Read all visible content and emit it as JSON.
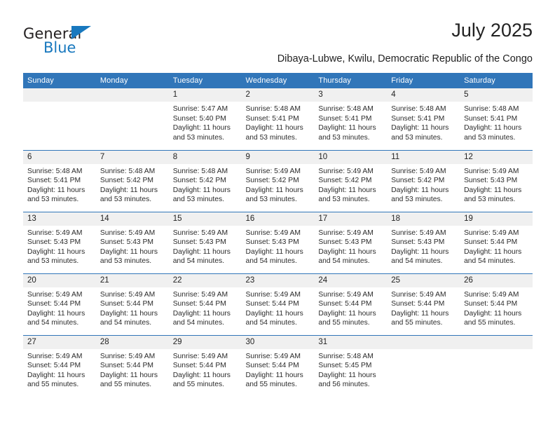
{
  "logo": {
    "word_top": "General",
    "word_bottom": "Blue",
    "triangle_icon": "triangle-icon",
    "color_blue": "#1878be",
    "color_dark": "#231f20"
  },
  "header": {
    "title": "July 2025",
    "subtitle": "Dibaya-Lubwe, Kwilu, Democratic Republic of the Congo"
  },
  "theme": {
    "header_blue": "#3176b9",
    "daynum_bg": "#f0f0f0",
    "text": "#222222"
  },
  "calendar": {
    "weekday_headers": [
      "Sunday",
      "Monday",
      "Tuesday",
      "Wednesday",
      "Thursday",
      "Friday",
      "Saturday"
    ],
    "weeks": [
      [
        {
          "day": "",
          "lines": []
        },
        {
          "day": "",
          "lines": []
        },
        {
          "day": "1",
          "lines": [
            "Sunrise: 5:47 AM",
            "Sunset: 5:40 PM",
            "Daylight: 11 hours",
            "and 53 minutes."
          ]
        },
        {
          "day": "2",
          "lines": [
            "Sunrise: 5:48 AM",
            "Sunset: 5:41 PM",
            "Daylight: 11 hours",
            "and 53 minutes."
          ]
        },
        {
          "day": "3",
          "lines": [
            "Sunrise: 5:48 AM",
            "Sunset: 5:41 PM",
            "Daylight: 11 hours",
            "and 53 minutes."
          ]
        },
        {
          "day": "4",
          "lines": [
            "Sunrise: 5:48 AM",
            "Sunset: 5:41 PM",
            "Daylight: 11 hours",
            "and 53 minutes."
          ]
        },
        {
          "day": "5",
          "lines": [
            "Sunrise: 5:48 AM",
            "Sunset: 5:41 PM",
            "Daylight: 11 hours",
            "and 53 minutes."
          ]
        }
      ],
      [
        {
          "day": "6",
          "lines": [
            "Sunrise: 5:48 AM",
            "Sunset: 5:41 PM",
            "Daylight: 11 hours",
            "and 53 minutes."
          ]
        },
        {
          "day": "7",
          "lines": [
            "Sunrise: 5:48 AM",
            "Sunset: 5:42 PM",
            "Daylight: 11 hours",
            "and 53 minutes."
          ]
        },
        {
          "day": "8",
          "lines": [
            "Sunrise: 5:48 AM",
            "Sunset: 5:42 PM",
            "Daylight: 11 hours",
            "and 53 minutes."
          ]
        },
        {
          "day": "9",
          "lines": [
            "Sunrise: 5:49 AM",
            "Sunset: 5:42 PM",
            "Daylight: 11 hours",
            "and 53 minutes."
          ]
        },
        {
          "day": "10",
          "lines": [
            "Sunrise: 5:49 AM",
            "Sunset: 5:42 PM",
            "Daylight: 11 hours",
            "and 53 minutes."
          ]
        },
        {
          "day": "11",
          "lines": [
            "Sunrise: 5:49 AM",
            "Sunset: 5:42 PM",
            "Daylight: 11 hours",
            "and 53 minutes."
          ]
        },
        {
          "day": "12",
          "lines": [
            "Sunrise: 5:49 AM",
            "Sunset: 5:43 PM",
            "Daylight: 11 hours",
            "and 53 minutes."
          ]
        }
      ],
      [
        {
          "day": "13",
          "lines": [
            "Sunrise: 5:49 AM",
            "Sunset: 5:43 PM",
            "Daylight: 11 hours",
            "and 53 minutes."
          ]
        },
        {
          "day": "14",
          "lines": [
            "Sunrise: 5:49 AM",
            "Sunset: 5:43 PM",
            "Daylight: 11 hours",
            "and 53 minutes."
          ]
        },
        {
          "day": "15",
          "lines": [
            "Sunrise: 5:49 AM",
            "Sunset: 5:43 PM",
            "Daylight: 11 hours",
            "and 54 minutes."
          ]
        },
        {
          "day": "16",
          "lines": [
            "Sunrise: 5:49 AM",
            "Sunset: 5:43 PM",
            "Daylight: 11 hours",
            "and 54 minutes."
          ]
        },
        {
          "day": "17",
          "lines": [
            "Sunrise: 5:49 AM",
            "Sunset: 5:43 PM",
            "Daylight: 11 hours",
            "and 54 minutes."
          ]
        },
        {
          "day": "18",
          "lines": [
            "Sunrise: 5:49 AM",
            "Sunset: 5:43 PM",
            "Daylight: 11 hours",
            "and 54 minutes."
          ]
        },
        {
          "day": "19",
          "lines": [
            "Sunrise: 5:49 AM",
            "Sunset: 5:44 PM",
            "Daylight: 11 hours",
            "and 54 minutes."
          ]
        }
      ],
      [
        {
          "day": "20",
          "lines": [
            "Sunrise: 5:49 AM",
            "Sunset: 5:44 PM",
            "Daylight: 11 hours",
            "and 54 minutes."
          ]
        },
        {
          "day": "21",
          "lines": [
            "Sunrise: 5:49 AM",
            "Sunset: 5:44 PM",
            "Daylight: 11 hours",
            "and 54 minutes."
          ]
        },
        {
          "day": "22",
          "lines": [
            "Sunrise: 5:49 AM",
            "Sunset: 5:44 PM",
            "Daylight: 11 hours",
            "and 54 minutes."
          ]
        },
        {
          "day": "23",
          "lines": [
            "Sunrise: 5:49 AM",
            "Sunset: 5:44 PM",
            "Daylight: 11 hours",
            "and 54 minutes."
          ]
        },
        {
          "day": "24",
          "lines": [
            "Sunrise: 5:49 AM",
            "Sunset: 5:44 PM",
            "Daylight: 11 hours",
            "and 55 minutes."
          ]
        },
        {
          "day": "25",
          "lines": [
            "Sunrise: 5:49 AM",
            "Sunset: 5:44 PM",
            "Daylight: 11 hours",
            "and 55 minutes."
          ]
        },
        {
          "day": "26",
          "lines": [
            "Sunrise: 5:49 AM",
            "Sunset: 5:44 PM",
            "Daylight: 11 hours",
            "and 55 minutes."
          ]
        }
      ],
      [
        {
          "day": "27",
          "lines": [
            "Sunrise: 5:49 AM",
            "Sunset: 5:44 PM",
            "Daylight: 11 hours",
            "and 55 minutes."
          ]
        },
        {
          "day": "28",
          "lines": [
            "Sunrise: 5:49 AM",
            "Sunset: 5:44 PM",
            "Daylight: 11 hours",
            "and 55 minutes."
          ]
        },
        {
          "day": "29",
          "lines": [
            "Sunrise: 5:49 AM",
            "Sunset: 5:44 PM",
            "Daylight: 11 hours",
            "and 55 minutes."
          ]
        },
        {
          "day": "30",
          "lines": [
            "Sunrise: 5:49 AM",
            "Sunset: 5:44 PM",
            "Daylight: 11 hours",
            "and 55 minutes."
          ]
        },
        {
          "day": "31",
          "lines": [
            "Sunrise: 5:48 AM",
            "Sunset: 5:45 PM",
            "Daylight: 11 hours",
            "and 56 minutes."
          ]
        },
        {
          "day": "",
          "lines": []
        },
        {
          "day": "",
          "lines": []
        }
      ]
    ]
  }
}
